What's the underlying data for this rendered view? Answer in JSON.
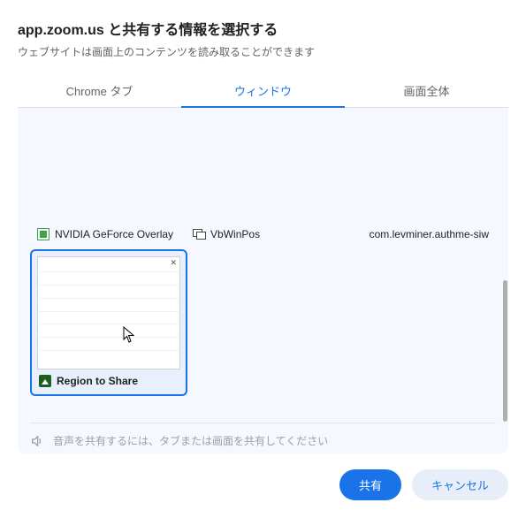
{
  "title": "app.zoom.us と共有する情報を選択する",
  "subtitle": "ウェブサイトは画面上のコンテンツを読み取ることができます",
  "tabs": {
    "chrome": "Chrome タブ",
    "window": "ウィンドウ",
    "screen": "画面全体"
  },
  "items": {
    "nvidia": "NVIDIA GeForce Overlay",
    "vbwinpos": "VbWinPos",
    "authme": "com.levminer.authme-siw"
  },
  "selected": {
    "label": "Region to Share"
  },
  "audio_hint": "音声を共有するには、タブまたは画面を共有してください",
  "buttons": {
    "share": "共有",
    "cancel": "キャンセル"
  }
}
